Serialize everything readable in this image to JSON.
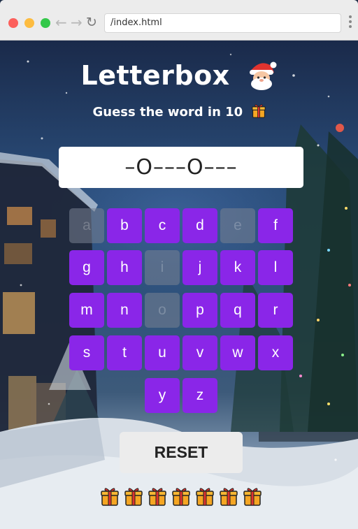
{
  "browser": {
    "address": "/index.html",
    "back_icon": "back-arrow-icon",
    "forward_icon": "forward-arrow-icon",
    "reload_icon": "reload-icon"
  },
  "game": {
    "title": "Letterbox",
    "title_emoji": "santa-emoji",
    "subtitle": "Guess the word in 10",
    "subtitle_emoji": "gift-emoji",
    "word_display": "–O–––O–––",
    "keys": [
      {
        "letter": "a",
        "used": true
      },
      {
        "letter": "b",
        "used": false
      },
      {
        "letter": "c",
        "used": false
      },
      {
        "letter": "d",
        "used": false
      },
      {
        "letter": "e",
        "used": true
      },
      {
        "letter": "f",
        "used": false
      },
      {
        "letter": "g",
        "used": false
      },
      {
        "letter": "h",
        "used": false
      },
      {
        "letter": "i",
        "used": true
      },
      {
        "letter": "j",
        "used": false
      },
      {
        "letter": "k",
        "used": false
      },
      {
        "letter": "l",
        "used": false
      },
      {
        "letter": "m",
        "used": false
      },
      {
        "letter": "n",
        "used": false
      },
      {
        "letter": "o",
        "used": true
      },
      {
        "letter": "p",
        "used": false
      },
      {
        "letter": "q",
        "used": false
      },
      {
        "letter": "r",
        "used": false
      },
      {
        "letter": "s",
        "used": false
      },
      {
        "letter": "t",
        "used": false
      },
      {
        "letter": "u",
        "used": false
      },
      {
        "letter": "v",
        "used": false
      },
      {
        "letter": "w",
        "used": false
      },
      {
        "letter": "x",
        "used": false
      },
      {
        "letter": "y",
        "used": false
      },
      {
        "letter": "z",
        "used": false
      }
    ],
    "reset_label": "RESET",
    "lives_remaining": 7,
    "life_icon": "gift-icon"
  },
  "colors": {
    "key_active": "#8a26e8",
    "key_used": "#787f8c",
    "word_box": "#ffffff",
    "reset_button": "#ececec"
  }
}
